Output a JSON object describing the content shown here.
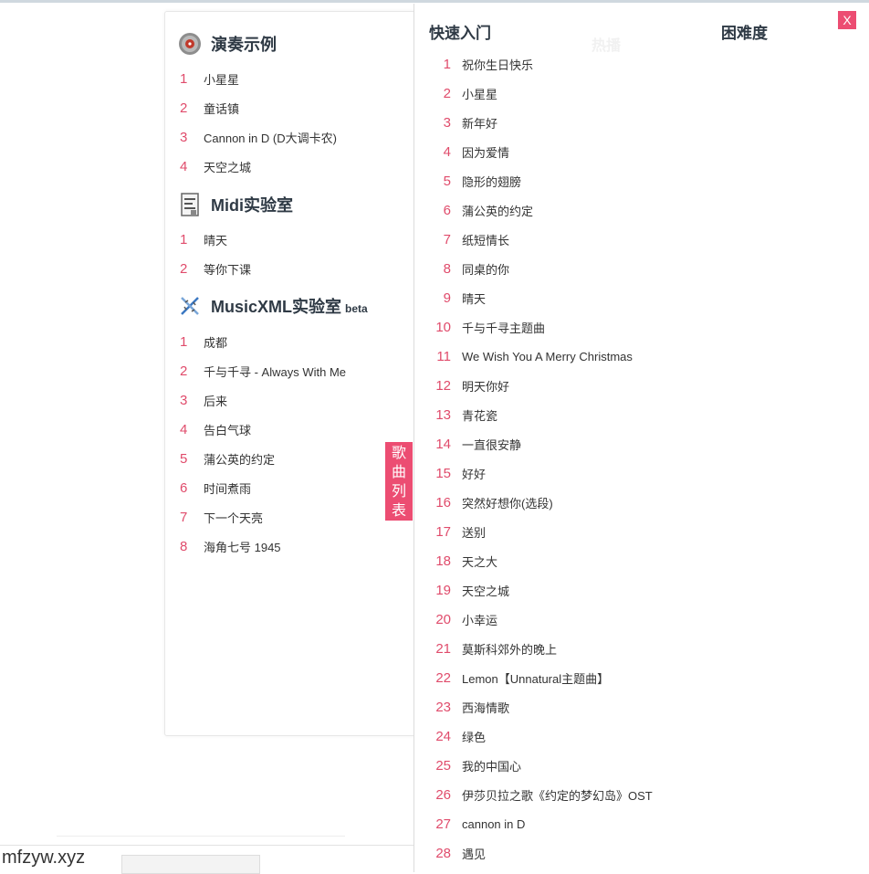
{
  "sections": {
    "demo": {
      "title": "演奏示例",
      "icon": "vinyl-disc-icon",
      "items": [
        "小星星",
        "童话镇",
        "Cannon in D (D大调卡农)",
        "天空之城"
      ]
    },
    "midi": {
      "title": "Midi实验室",
      "icon": "midi-file-icon",
      "items": [
        "晴天",
        "等你下课"
      ]
    },
    "musicxml": {
      "title": "MusicXML实验室",
      "badge": "beta",
      "icon": "dna-helix-icon",
      "items": [
        "成都",
        "千与千寻 - Always With Me",
        "后来",
        "告白气球",
        "蒲公英的约定",
        "时间煮雨",
        "下一个天亮",
        "海角七号 1945"
      ]
    }
  },
  "side_tab": [
    "歌",
    "曲",
    "列",
    "表"
  ],
  "panel": {
    "tabs": [
      "快速入门",
      "困难度"
    ],
    "ghost_tab": "热播",
    "close_label": "X",
    "quick_start": [
      "祝你生日快乐",
      "小星星",
      "新年好",
      "因为爱情",
      "隐形的翅膀",
      "蒲公英的约定",
      "纸短情长",
      "同桌的你",
      "晴天",
      "千与千寻主题曲",
      "We Wish You A Merry Christmas",
      "明天你好",
      "青花瓷",
      "一直很安静",
      "好好",
      "突然好想你(选段)",
      "送别",
      "天之大",
      "天空之城",
      "小幸运",
      "莫斯科郊外的晚上",
      "Lemon【Unnatural主题曲】",
      "西海情歌",
      "绿色",
      "我的中国心",
      "伊莎贝拉之歌《约定的梦幻岛》OST",
      "cannon in D",
      "遇见"
    ]
  },
  "watermark": "mfzyw.xyz",
  "colors": {
    "accent": "#ec4d72",
    "number": "#e04b6b",
    "heading": "#2f3a45"
  }
}
